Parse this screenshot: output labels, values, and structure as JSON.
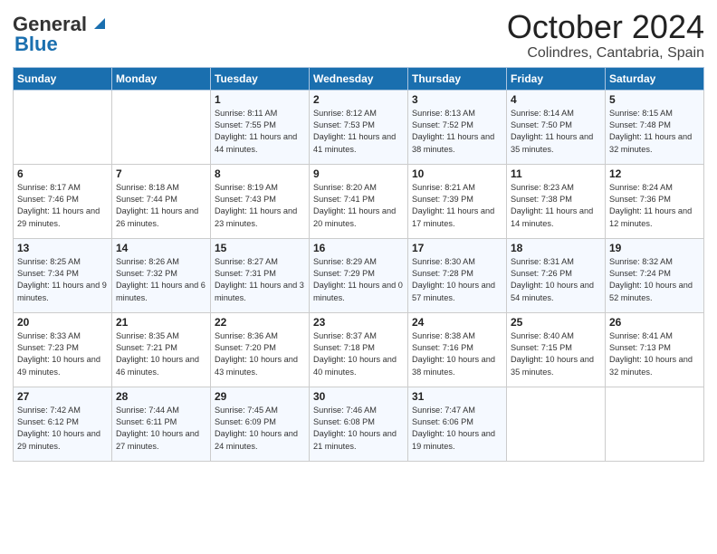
{
  "header": {
    "logo_general": "General",
    "logo_blue": "Blue",
    "month": "October 2024",
    "location": "Colindres, Cantabria, Spain"
  },
  "days_of_week": [
    "Sunday",
    "Monday",
    "Tuesday",
    "Wednesday",
    "Thursday",
    "Friday",
    "Saturday"
  ],
  "weeks": [
    [
      {
        "day": "",
        "info": ""
      },
      {
        "day": "",
        "info": ""
      },
      {
        "day": "1",
        "info": "Sunrise: 8:11 AM\nSunset: 7:55 PM\nDaylight: 11 hours and 44 minutes."
      },
      {
        "day": "2",
        "info": "Sunrise: 8:12 AM\nSunset: 7:53 PM\nDaylight: 11 hours and 41 minutes."
      },
      {
        "day": "3",
        "info": "Sunrise: 8:13 AM\nSunset: 7:52 PM\nDaylight: 11 hours and 38 minutes."
      },
      {
        "day": "4",
        "info": "Sunrise: 8:14 AM\nSunset: 7:50 PM\nDaylight: 11 hours and 35 minutes."
      },
      {
        "day": "5",
        "info": "Sunrise: 8:15 AM\nSunset: 7:48 PM\nDaylight: 11 hours and 32 minutes."
      }
    ],
    [
      {
        "day": "6",
        "info": "Sunrise: 8:17 AM\nSunset: 7:46 PM\nDaylight: 11 hours and 29 minutes."
      },
      {
        "day": "7",
        "info": "Sunrise: 8:18 AM\nSunset: 7:44 PM\nDaylight: 11 hours and 26 minutes."
      },
      {
        "day": "8",
        "info": "Sunrise: 8:19 AM\nSunset: 7:43 PM\nDaylight: 11 hours and 23 minutes."
      },
      {
        "day": "9",
        "info": "Sunrise: 8:20 AM\nSunset: 7:41 PM\nDaylight: 11 hours and 20 minutes."
      },
      {
        "day": "10",
        "info": "Sunrise: 8:21 AM\nSunset: 7:39 PM\nDaylight: 11 hours and 17 minutes."
      },
      {
        "day": "11",
        "info": "Sunrise: 8:23 AM\nSunset: 7:38 PM\nDaylight: 11 hours and 14 minutes."
      },
      {
        "day": "12",
        "info": "Sunrise: 8:24 AM\nSunset: 7:36 PM\nDaylight: 11 hours and 12 minutes."
      }
    ],
    [
      {
        "day": "13",
        "info": "Sunrise: 8:25 AM\nSunset: 7:34 PM\nDaylight: 11 hours and 9 minutes."
      },
      {
        "day": "14",
        "info": "Sunrise: 8:26 AM\nSunset: 7:32 PM\nDaylight: 11 hours and 6 minutes."
      },
      {
        "day": "15",
        "info": "Sunrise: 8:27 AM\nSunset: 7:31 PM\nDaylight: 11 hours and 3 minutes."
      },
      {
        "day": "16",
        "info": "Sunrise: 8:29 AM\nSunset: 7:29 PM\nDaylight: 11 hours and 0 minutes."
      },
      {
        "day": "17",
        "info": "Sunrise: 8:30 AM\nSunset: 7:28 PM\nDaylight: 10 hours and 57 minutes."
      },
      {
        "day": "18",
        "info": "Sunrise: 8:31 AM\nSunset: 7:26 PM\nDaylight: 10 hours and 54 minutes."
      },
      {
        "day": "19",
        "info": "Sunrise: 8:32 AM\nSunset: 7:24 PM\nDaylight: 10 hours and 52 minutes."
      }
    ],
    [
      {
        "day": "20",
        "info": "Sunrise: 8:33 AM\nSunset: 7:23 PM\nDaylight: 10 hours and 49 minutes."
      },
      {
        "day": "21",
        "info": "Sunrise: 8:35 AM\nSunset: 7:21 PM\nDaylight: 10 hours and 46 minutes."
      },
      {
        "day": "22",
        "info": "Sunrise: 8:36 AM\nSunset: 7:20 PM\nDaylight: 10 hours and 43 minutes."
      },
      {
        "day": "23",
        "info": "Sunrise: 8:37 AM\nSunset: 7:18 PM\nDaylight: 10 hours and 40 minutes."
      },
      {
        "day": "24",
        "info": "Sunrise: 8:38 AM\nSunset: 7:16 PM\nDaylight: 10 hours and 38 minutes."
      },
      {
        "day": "25",
        "info": "Sunrise: 8:40 AM\nSunset: 7:15 PM\nDaylight: 10 hours and 35 minutes."
      },
      {
        "day": "26",
        "info": "Sunrise: 8:41 AM\nSunset: 7:13 PM\nDaylight: 10 hours and 32 minutes."
      }
    ],
    [
      {
        "day": "27",
        "info": "Sunrise: 7:42 AM\nSunset: 6:12 PM\nDaylight: 10 hours and 29 minutes."
      },
      {
        "day": "28",
        "info": "Sunrise: 7:44 AM\nSunset: 6:11 PM\nDaylight: 10 hours and 27 minutes."
      },
      {
        "day": "29",
        "info": "Sunrise: 7:45 AM\nSunset: 6:09 PM\nDaylight: 10 hours and 24 minutes."
      },
      {
        "day": "30",
        "info": "Sunrise: 7:46 AM\nSunset: 6:08 PM\nDaylight: 10 hours and 21 minutes."
      },
      {
        "day": "31",
        "info": "Sunrise: 7:47 AM\nSunset: 6:06 PM\nDaylight: 10 hours and 19 minutes."
      },
      {
        "day": "",
        "info": ""
      },
      {
        "day": "",
        "info": ""
      }
    ]
  ]
}
